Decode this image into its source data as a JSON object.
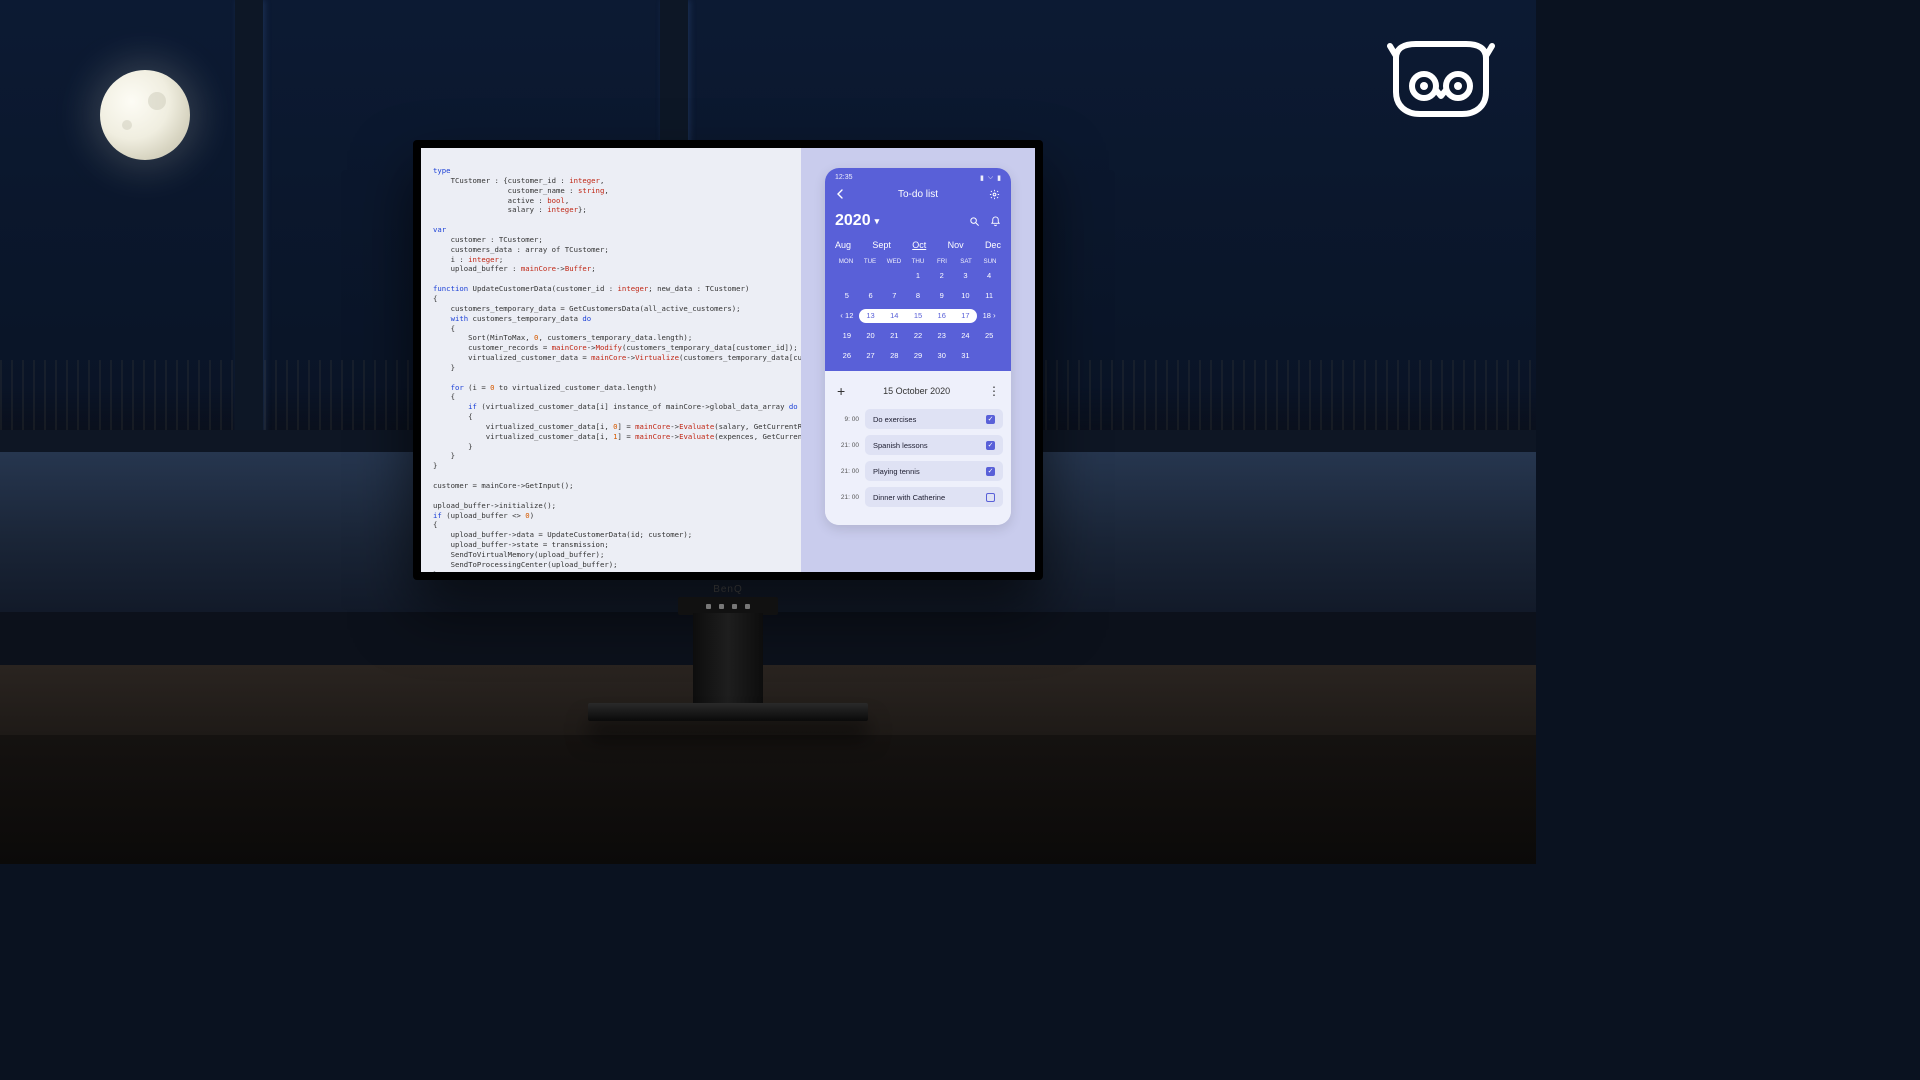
{
  "brand": "BenQ",
  "code": {
    "tokens": [
      [
        "kw",
        "type"
      ],
      [
        "",
        "\n"
      ],
      [
        "",
        "    TCustomer : {customer_id : "
      ],
      [
        "str",
        "integer"
      ],
      [
        "",
        ",\n"
      ],
      [
        "",
        "                 customer_name : "
      ],
      [
        "str",
        "string"
      ],
      [
        "",
        ",\n"
      ],
      [
        "",
        "                 active : "
      ],
      [
        "str",
        "bool"
      ],
      [
        "",
        ",\n"
      ],
      [
        "",
        "                 salary : "
      ],
      [
        "str",
        "integer"
      ],
      [
        "",
        "};\n\n"
      ],
      [
        "kw",
        "var"
      ],
      [
        "",
        "\n"
      ],
      [
        "",
        "    customer : TCustomer;\n"
      ],
      [
        "",
        "    customers_data : array of TCustomer;\n"
      ],
      [
        "",
        "    i : "
      ],
      [
        "str",
        "integer"
      ],
      [
        "",
        ";\n"
      ],
      [
        "",
        "    upload_buffer : "
      ],
      [
        "str",
        "mainCore"
      ],
      [
        "",
        "->"
      ],
      [
        "str",
        "Buffer"
      ],
      [
        "",
        ";\n\n"
      ],
      [
        "kw",
        "function"
      ],
      [
        "",
        " UpdateCustomerData(customer_id : "
      ],
      [
        "str",
        "integer"
      ],
      [
        "",
        "; new_data : TCustomer)\n{\n"
      ],
      [
        "",
        "    customers_temporary_data = GetCustomersData(all_active_customers);\n"
      ],
      [
        "",
        "    "
      ],
      [
        "kw",
        "with"
      ],
      [
        "",
        " customers_temporary_data "
      ],
      [
        "kw",
        "do"
      ],
      [
        "",
        "\n    {\n"
      ],
      [
        "",
        "        Sort(MinToMax, "
      ],
      [
        "num",
        "0"
      ],
      [
        "",
        ", customers_temporary_data.length);\n"
      ],
      [
        "",
        "        customer_records = "
      ],
      [
        "str",
        "mainCore"
      ],
      [
        "",
        "->"
      ],
      [
        "str",
        "Modify"
      ],
      [
        "",
        "(customers_temporary_data[customer_id]);\n"
      ],
      [
        "",
        "        virtualized_customer_data = "
      ],
      [
        "str",
        "mainCore"
      ],
      [
        "",
        "->"
      ],
      [
        "str",
        "Virtualize"
      ],
      [
        "",
        "(customers_temporary_data[customer_id]);\n"
      ],
      [
        "",
        "    }\n\n"
      ],
      [
        "",
        "    "
      ],
      [
        "kw",
        "for"
      ],
      [
        "",
        " (i = "
      ],
      [
        "num",
        "0"
      ],
      [
        "",
        " to virtualized_customer_data.length)\n    {\n"
      ],
      [
        "",
        "        "
      ],
      [
        "kw",
        "if"
      ],
      [
        "",
        " (virtualized_customer_data[i] instance_of mainCore->global_data_array "
      ],
      [
        "kw",
        "do"
      ],
      [
        "",
        "\n        {\n"
      ],
      [
        "",
        "            virtualized_customer_data[i, "
      ],
      [
        "num",
        "0"
      ],
      [
        "",
        "] = "
      ],
      [
        "str",
        "mainCore"
      ],
      [
        "",
        "->"
      ],
      [
        "str",
        "Evaluate"
      ],
      [
        "",
        "(salary, GetCurrentRate);\n"
      ],
      [
        "",
        "            virtualized_customer_data[i, "
      ],
      [
        "num",
        "1"
      ],
      [
        "",
        "] = "
      ],
      [
        "str",
        "mainCore"
      ],
      [
        "",
        "->"
      ],
      [
        "str",
        "Evaluate"
      ],
      [
        "",
        "(expences, GetCurrentRate);\n"
      ],
      [
        "",
        "        }\n    }\n}\n\n"
      ],
      [
        "",
        "customer = mainCore->GetInput();\n\n"
      ],
      [
        "",
        "upload_buffer->initialize();\n"
      ],
      [
        "kw",
        "if"
      ],
      [
        "",
        " (upload_buffer <> "
      ],
      [
        "num",
        "0"
      ],
      [
        "",
        ")\n{\n"
      ],
      [
        "",
        "    upload_buffer->data = UpdateCustomerData(id; customer);\n"
      ],
      [
        "",
        "    upload_buffer->state = transmission;\n"
      ],
      [
        "",
        "    SendToVirtualMemory(upload_buffer);\n"
      ],
      [
        "",
        "    SendToProcessingCenter(upload_buffer);\n"
      ],
      [
        "",
        "}\n"
      ]
    ]
  },
  "phone": {
    "clock": "12:35",
    "title": "To-do list",
    "year": "2020",
    "months": [
      "Aug",
      "Sept",
      "Oct",
      "Nov",
      "Dec"
    ],
    "active_month_index": 2,
    "dow": [
      "MON",
      "TUE",
      "WED",
      "THU",
      "FRI",
      "SAT",
      "SUN"
    ],
    "weeks": [
      [
        "",
        "",
        "",
        "1",
        "2",
        "3",
        "4"
      ],
      [
        "5",
        "6",
        "7",
        "8",
        "9",
        "10",
        "11"
      ],
      [
        "12",
        "13",
        "14",
        "15",
        "16",
        "17",
        "18"
      ],
      [
        "19",
        "20",
        "21",
        "22",
        "23",
        "24",
        "25"
      ],
      [
        "26",
        "27",
        "28",
        "29",
        "30",
        "31",
        ""
      ]
    ],
    "highlight_week": 2,
    "highlight_start": 1,
    "highlight_end": 5,
    "selected_date": "15 October 2020",
    "tasks": [
      {
        "time": "9: 00",
        "label": "Do exercises",
        "done": true
      },
      {
        "time": "21: 00",
        "label": "Spanish lessons",
        "done": true
      },
      {
        "time": "21: 00",
        "label": "Playing tennis",
        "done": true
      },
      {
        "time": "21: 00",
        "label": "Dinner with Catherine",
        "done": false
      }
    ]
  }
}
